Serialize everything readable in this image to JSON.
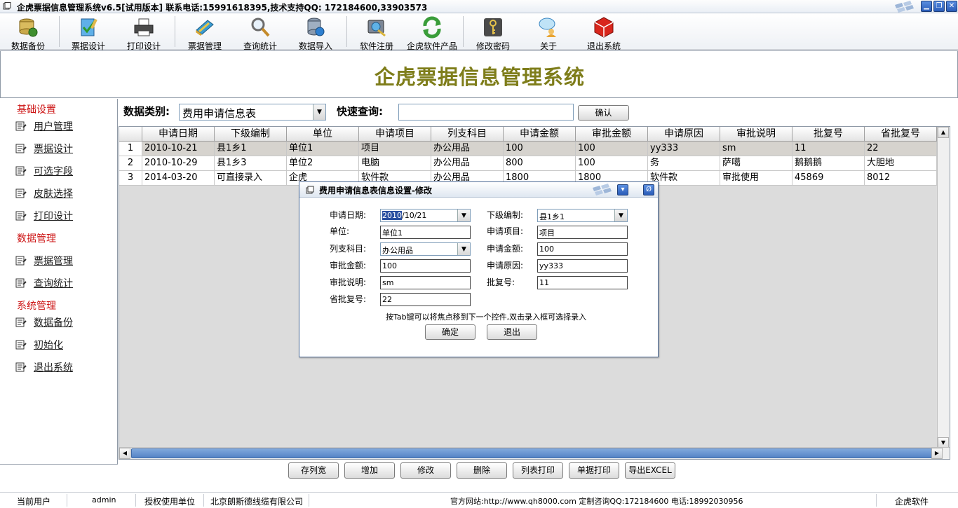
{
  "window": {
    "title": "企虎票据信息管理系统v6.5[试用版本]  联系电话:15991618395,技术支持QQ: 172184600,33903573"
  },
  "toolbar": {
    "items": [
      {
        "label": "数据备份",
        "icon": "database-backup-icon"
      },
      {
        "label": "票据设计",
        "icon": "ticket-design-icon"
      },
      {
        "label": "打印设计",
        "icon": "printer-icon"
      },
      {
        "label": "票据管理",
        "icon": "ticket-manage-icon"
      },
      {
        "label": "查询统计",
        "icon": "magnifier-icon"
      },
      {
        "label": "数据导入",
        "icon": "database-import-icon"
      },
      {
        "label": "软件注册",
        "icon": "register-icon"
      },
      {
        "label": "企虎软件产品",
        "icon": "refresh-icon"
      },
      {
        "label": "修改密码",
        "icon": "key-icon"
      },
      {
        "label": "关于",
        "icon": "about-icon"
      },
      {
        "label": "退出系统",
        "icon": "exit-cube-icon"
      }
    ]
  },
  "banner": {
    "title": "企虎票据信息管理系统"
  },
  "sidebar": {
    "groups": [
      {
        "title": "基础设置",
        "items": [
          "用户管理",
          "票据设计",
          "可选字段",
          "皮肤选择",
          "打印设计"
        ]
      },
      {
        "title": "数据管理",
        "items": [
          "票据管理",
          "查询统计"
        ]
      },
      {
        "title": "系统管理",
        "items": [
          "数据备份",
          "初始化",
          "退出系统"
        ]
      }
    ]
  },
  "filter": {
    "type_label": "数据类别:",
    "type_value": "费用申请信息表",
    "quick_label": "快速查询:",
    "quick_value": "",
    "confirm_label": "确认"
  },
  "grid": {
    "columns": [
      "申请日期",
      "下级编制",
      "单位",
      "申请项目",
      "列支科目",
      "申请金额",
      "审批金额",
      "申请原因",
      "审批说明",
      "批复号",
      "省批复号"
    ],
    "rows": [
      {
        "num": "1",
        "cells": [
          "2010-10-21",
          "县1乡1",
          "单位1",
          "项目",
          "办公用品",
          "100",
          "100",
          "yy333",
          "sm",
          "11",
          "22"
        ]
      },
      {
        "num": "2",
        "cells": [
          "2010-10-29",
          "县1乡3",
          "单位2",
          "电脑",
          "办公用品",
          "800",
          "100",
          "务",
          "萨噶",
          "鹅鹅鹅",
          "大胆地"
        ]
      },
      {
        "num": "3",
        "cells": [
          "2014-03-20",
          "可直接录入",
          "企虎",
          "软件款",
          "办公用品",
          "1800",
          "1800",
          "软件款",
          "审批使用",
          "45869",
          "8012"
        ]
      }
    ]
  },
  "dialog": {
    "title": "费用申请信息表信息设置-修改",
    "fields": {
      "apply_date": {
        "label": "申请日期:",
        "value_sel": "2010",
        "value_rest": "/10/21"
      },
      "sub_org": {
        "label": "下级编制:",
        "value": "县1乡1"
      },
      "unit": {
        "label": "单位:",
        "value": "单位1"
      },
      "project": {
        "label": "申请项目:",
        "value": "项目"
      },
      "subject": {
        "label": "列支科目:",
        "value": "办公用品"
      },
      "amount": {
        "label": "申请金额:",
        "value": "100"
      },
      "approved": {
        "label": "审批金额:",
        "value": "100"
      },
      "reason": {
        "label": "申请原因:",
        "value": "yy333"
      },
      "note": {
        "label": "审批说明:",
        "value": "sm"
      },
      "reply_no": {
        "label": "批复号:",
        "value": "11"
      },
      "prov_reply_no": {
        "label": "省批复号:",
        "value": "22"
      }
    },
    "hint": "按Tab键可以将焦点移到下一个控件,双击录入框可选择录入",
    "ok_label": "确定",
    "exit_label": "退出"
  },
  "actions": [
    "存列宽",
    "增加",
    "修改",
    "删除",
    "列表打印",
    "单据打印",
    "导出EXCEL"
  ],
  "status": {
    "user_label": "当前用户",
    "user_value": "admin",
    "auth_label": "授权使用单位",
    "auth_value": "北京朗斯德线缆有限公司",
    "site": "官方网站:http://www.qh8000.com 定制咨询QQ:172184600 电话:18992030956",
    "brand": "企虎软件"
  },
  "colors": {
    "banner_title": "#7e7d1a",
    "sidebar_group": "#cc1111",
    "selected_row": "#d6d3ce",
    "scroll_thumb": "#5583c5"
  }
}
